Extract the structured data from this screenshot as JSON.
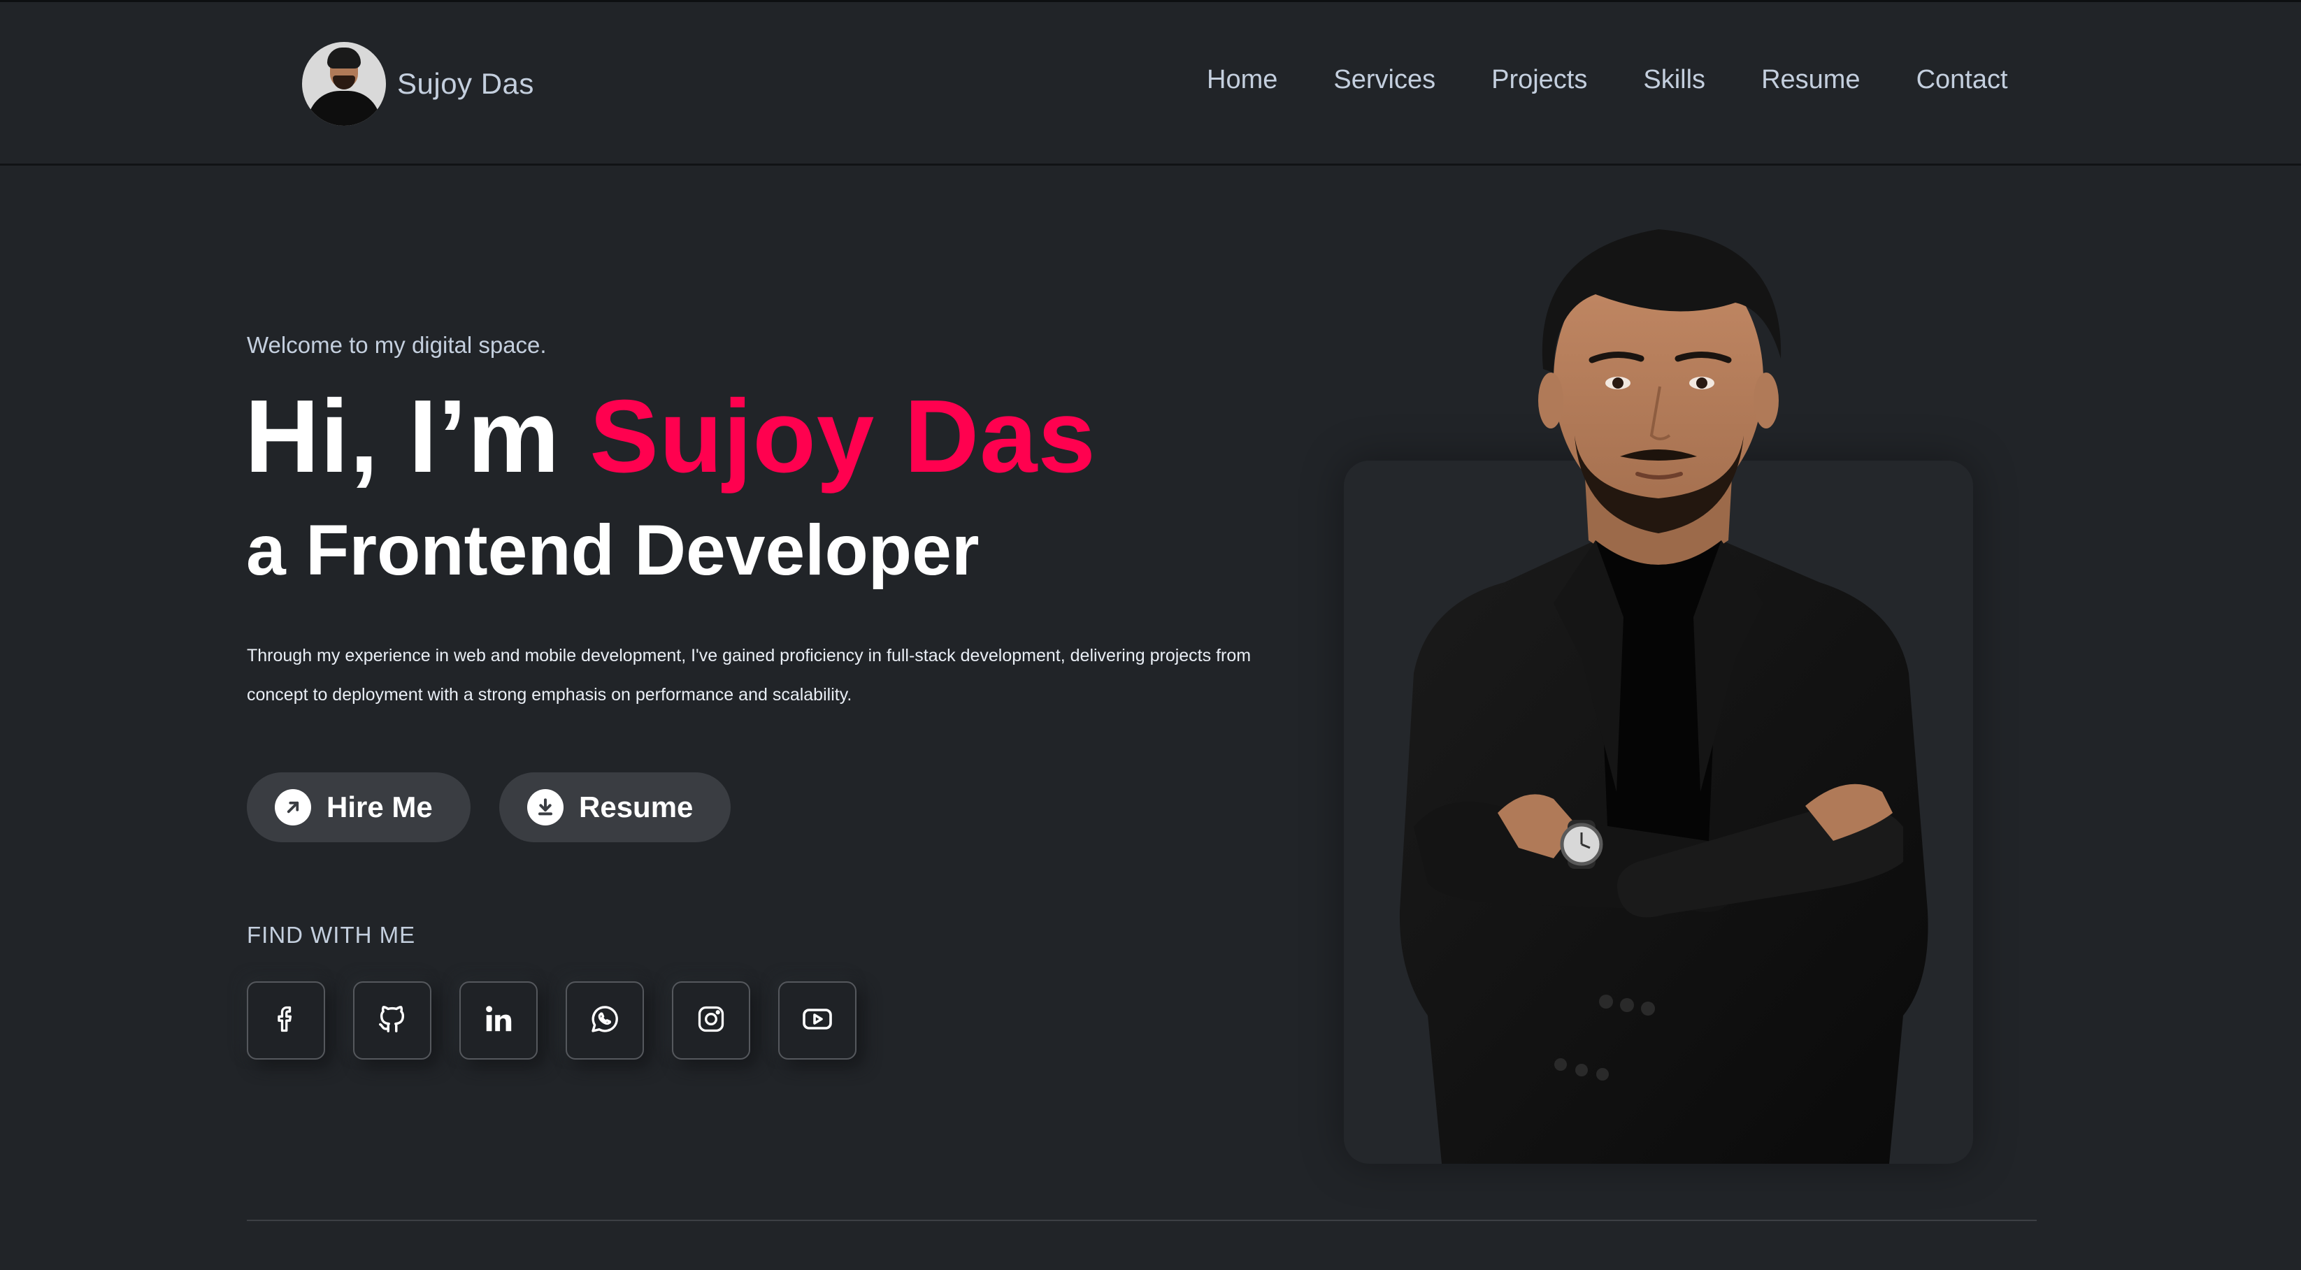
{
  "header": {
    "brand_name": "Sujoy Das",
    "nav": [
      "Home",
      "Services",
      "Projects",
      "Skills",
      "Resume",
      "Contact"
    ]
  },
  "hero": {
    "welcome": "Welcome to my digital space.",
    "title_prefix": "Hi, I’m ",
    "title_name": "Sujoy Das",
    "subtitle": "a Frontend Developer",
    "description": "Through my experience in web and mobile development, I've gained proficiency in full-stack development, delivering projects from concept to deployment with a strong emphasis on performance and scalability.",
    "buttons": {
      "hire": "Hire Me",
      "resume": "Resume"
    },
    "find_label": "FIND WITH ME"
  },
  "socials": [
    {
      "icon": "facebook-icon"
    },
    {
      "icon": "github-icon"
    },
    {
      "icon": "linkedin-icon"
    },
    {
      "icon": "whatsapp-icon"
    },
    {
      "icon": "instagram-icon"
    },
    {
      "icon": "youtube-icon"
    }
  ],
  "colors": {
    "background": "#212428",
    "accent": "#ff014f",
    "text": "#c4cfde",
    "button": "#3a3d42"
  }
}
